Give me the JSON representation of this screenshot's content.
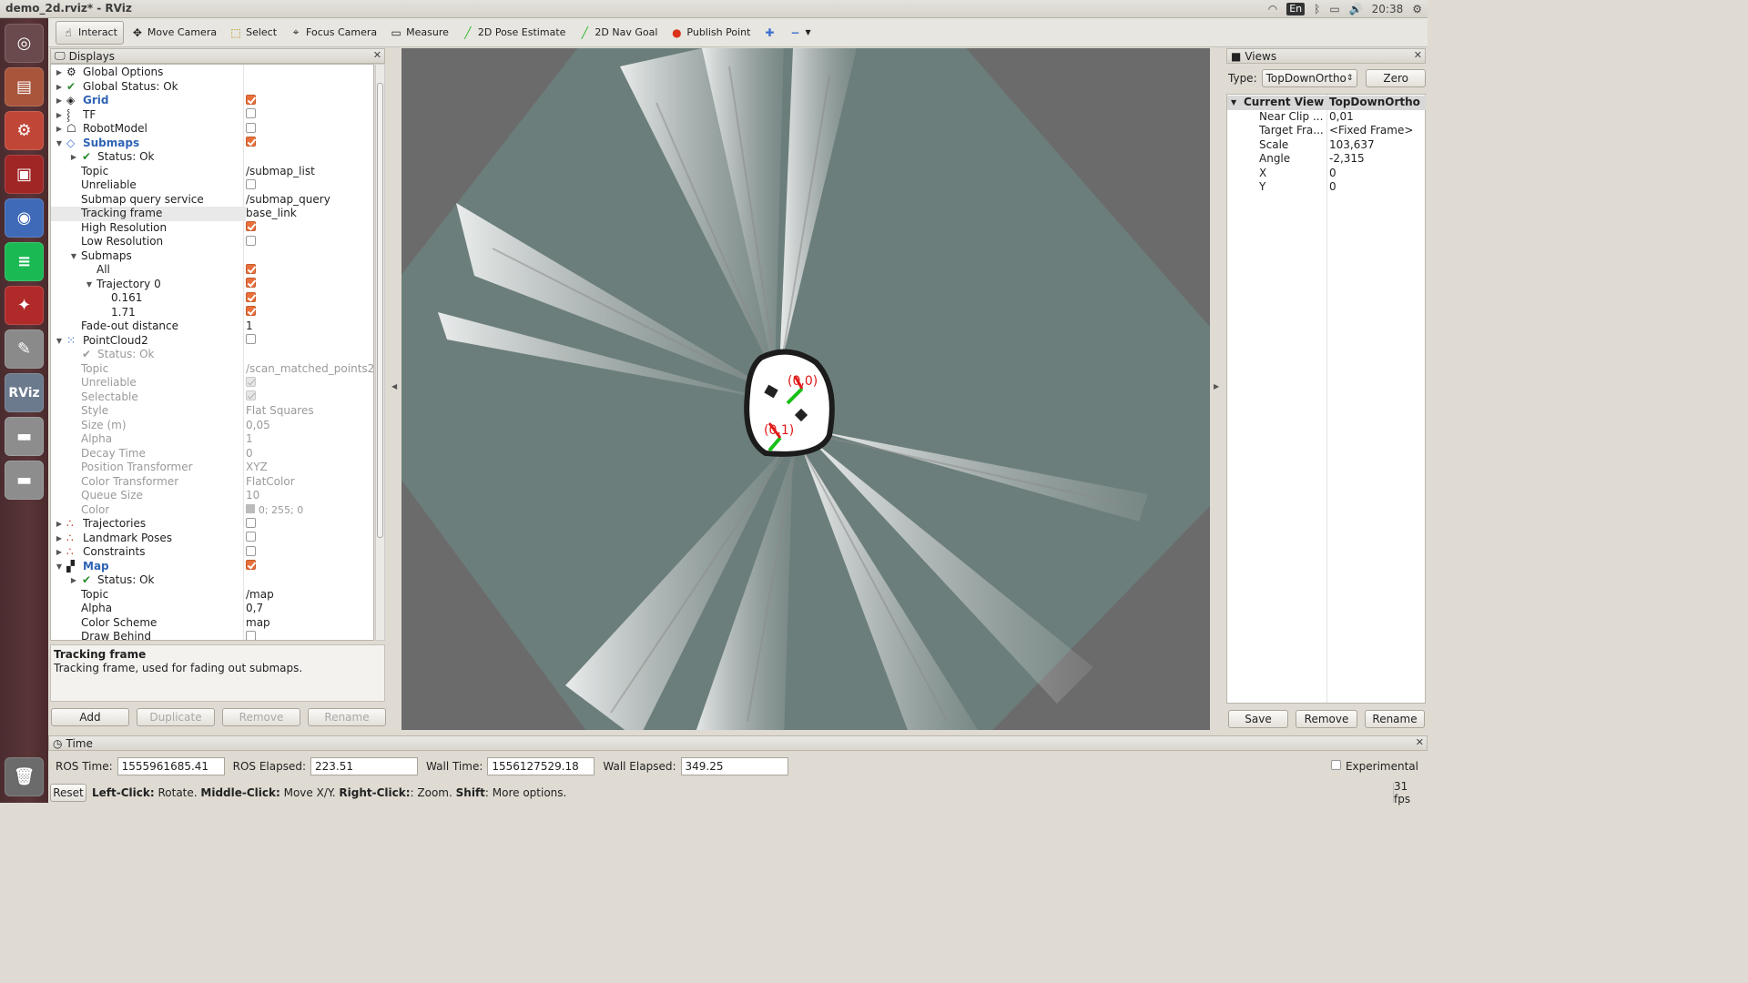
{
  "window": {
    "title": "demo_2d.rviz* - RViz"
  },
  "tray": {
    "lang": "En",
    "time": "20:38"
  },
  "toolbar": {
    "tools": [
      {
        "label": "Interact",
        "icon": "hand-icon"
      },
      {
        "label": "Move Camera",
        "icon": "move-icon"
      },
      {
        "label": "Select",
        "icon": "select-icon"
      },
      {
        "label": "Focus Camera",
        "icon": "focus-icon"
      },
      {
        "label": "Measure",
        "icon": "ruler-icon"
      },
      {
        "label": "2D Pose Estimate",
        "icon": "green-arrow-icon"
      },
      {
        "label": "2D Nav Goal",
        "icon": "green-arrow-icon"
      },
      {
        "label": "Publish Point",
        "icon": "pin-icon"
      }
    ]
  },
  "displays": {
    "title": "Displays",
    "rows": [
      {
        "label": "Global Options"
      },
      {
        "label": "Global Status: Ok"
      },
      {
        "label": "Grid"
      },
      {
        "label": "TF"
      },
      {
        "label": "RobotModel"
      },
      {
        "label": "Submaps"
      },
      {
        "label": "Status: Ok"
      },
      {
        "label": "Topic",
        "value": "/submap_list"
      },
      {
        "label": "Unreliable"
      },
      {
        "label": "Submap query service",
        "value": "/submap_query"
      },
      {
        "label": "Tracking frame",
        "value": "base_link"
      },
      {
        "label": "High Resolution"
      },
      {
        "label": "Low Resolution"
      },
      {
        "label": "Submaps"
      },
      {
        "label": "All"
      },
      {
        "label": "Trajectory 0"
      },
      {
        "label": "0.161"
      },
      {
        "label": "1.71"
      },
      {
        "label": "Fade-out distance",
        "value": "1"
      },
      {
        "label": "PointCloud2"
      },
      {
        "label": "Status: Ok"
      },
      {
        "label": "Topic",
        "value": "/scan_matched_points2"
      },
      {
        "label": "Unreliable"
      },
      {
        "label": "Selectable"
      },
      {
        "label": "Style",
        "value": "Flat Squares"
      },
      {
        "label": "Size (m)",
        "value": "0,05"
      },
      {
        "label": "Alpha",
        "value": "1"
      },
      {
        "label": "Decay Time",
        "value": "0"
      },
      {
        "label": "Position Transformer",
        "value": "XYZ"
      },
      {
        "label": "Color Transformer",
        "value": "FlatColor"
      },
      {
        "label": "Queue Size",
        "value": "10"
      },
      {
        "label": "Color",
        "value": "0; 255; 0"
      },
      {
        "label": "Trajectories"
      },
      {
        "label": "Landmark Poses"
      },
      {
        "label": "Constraints"
      },
      {
        "label": "Map"
      },
      {
        "label": "Status: Ok"
      },
      {
        "label": "Topic",
        "value": "/map"
      },
      {
        "label": "Alpha",
        "value": "0,7"
      },
      {
        "label": "Color Scheme",
        "value": "map"
      },
      {
        "label": "Draw Behind"
      }
    ],
    "desc_title": "Tracking frame",
    "desc_text": "Tracking frame, used for fading out submaps.",
    "buttons": {
      "add": "Add",
      "duplicate": "Duplicate",
      "remove": "Remove",
      "rename": "Rename"
    }
  },
  "viewport": {
    "frame_label_0": "(0,0)",
    "frame_label_1": "(0,1)"
  },
  "views": {
    "title": "Views",
    "type_label": "Type:",
    "type_value": "TopDownOrtho",
    "zero": "Zero",
    "current_view": {
      "label": "Current View",
      "value": "TopDownOrtho ..."
    },
    "props": [
      {
        "label": "Near Clip ...",
        "value": "0,01"
      },
      {
        "label": "Target Fra...",
        "value": "<Fixed Frame>"
      },
      {
        "label": "Scale",
        "value": "103,637"
      },
      {
        "label": "Angle",
        "value": "-2,315"
      },
      {
        "label": "X",
        "value": "0"
      },
      {
        "label": "Y",
        "value": "0"
      }
    ],
    "buttons": {
      "save": "Save",
      "remove": "Remove",
      "rename": "Rename"
    }
  },
  "time": {
    "title": "Time",
    "ros_time_label": "ROS Time:",
    "ros_time": "1555961685.41",
    "ros_elapsed_label": "ROS Elapsed:",
    "ros_elapsed": "223.51",
    "wall_time_label": "Wall Time:",
    "wall_time": "1556127529.18",
    "wall_elapsed_label": "Wall Elapsed:",
    "wall_elapsed": "349.25",
    "experimental": "Experimental"
  },
  "status": {
    "reset": "Reset",
    "left_click": "Left-Click:",
    "left_action": " Rotate. ",
    "middle_click": "Middle-Click:",
    "middle_action": " Move X/Y. ",
    "right_click": "Right-Click:",
    "right_action": ": Zoom. ",
    "shift": "Shift",
    "shift_action": ": More options.",
    "fps": "31 fps"
  }
}
